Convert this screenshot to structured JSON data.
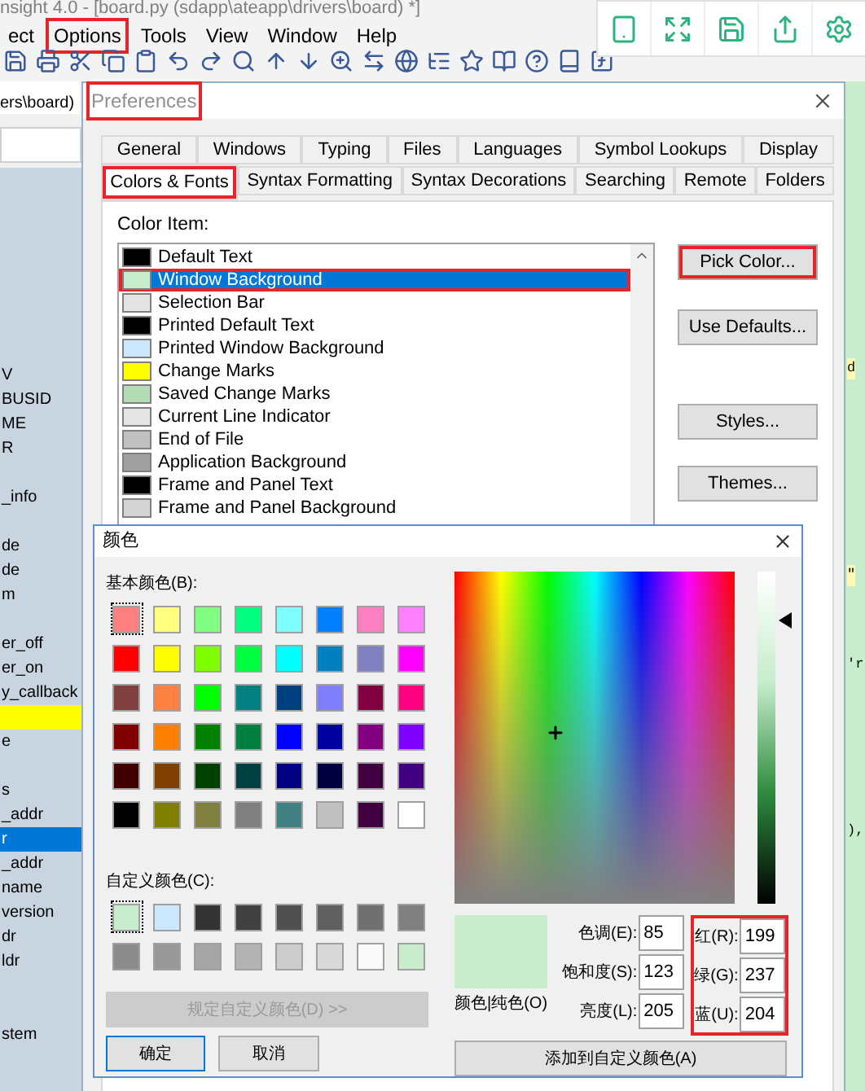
{
  "app": {
    "title": "nsight 4.0 - [board.py (sdapp\\ateapp\\drivers\\board) *]",
    "menu": [
      {
        "label": "ect",
        "highlighted": false
      },
      {
        "label": "Options",
        "highlighted": true
      },
      {
        "label": "Tools",
        "highlighted": false
      },
      {
        "label": "View",
        "highlighted": false
      },
      {
        "label": "Window",
        "highlighted": false
      },
      {
        "label": "Help",
        "highlighted": false
      }
    ]
  },
  "sidebar": {
    "tab": "ers\\board)",
    "rows": [
      {
        "kind": "blank"
      },
      {
        "kind": "blank"
      },
      {
        "kind": "blank"
      },
      {
        "kind": "blank"
      },
      {
        "kind": "blank"
      },
      {
        "kind": "blank"
      },
      {
        "kind": "blank"
      },
      {
        "kind": "blank"
      },
      {
        "kind": "text",
        "text": "V",
        "selected": false
      },
      {
        "kind": "text",
        "text": "BUSID",
        "selected": false
      },
      {
        "kind": "text",
        "text": "ME",
        "selected": false
      },
      {
        "kind": "text",
        "text": "R",
        "selected": false
      },
      {
        "kind": "blank"
      },
      {
        "kind": "text",
        "text": "_info",
        "selected": false
      },
      {
        "kind": "blank"
      },
      {
        "kind": "text",
        "text": "de",
        "selected": false
      },
      {
        "kind": "text",
        "text": "de",
        "selected": false
      },
      {
        "kind": "text",
        "text": "m",
        "selected": false
      },
      {
        "kind": "blank"
      },
      {
        "kind": "text",
        "text": "er_off",
        "selected": false
      },
      {
        "kind": "text",
        "text": "er_on",
        "selected": false
      },
      {
        "kind": "text",
        "text": "y_callback",
        "selected": false
      },
      {
        "kind": "blank",
        "selected": false,
        "marked": true
      },
      {
        "kind": "text",
        "text": "e",
        "selected": false
      },
      {
        "kind": "blank"
      },
      {
        "kind": "text",
        "text": "s",
        "selected": false
      },
      {
        "kind": "text",
        "text": "_addr",
        "selected": false
      },
      {
        "kind": "text",
        "text": "r",
        "selected": true
      },
      {
        "kind": "text",
        "text": "_addr",
        "selected": false
      },
      {
        "kind": "text",
        "text": "name",
        "selected": false
      },
      {
        "kind": "text",
        "text": "version",
        "selected": false
      },
      {
        "kind": "text",
        "text": "dr",
        "selected": false
      },
      {
        "kind": "text",
        "text": "ldr",
        "selected": false
      },
      {
        "kind": "blank"
      },
      {
        "kind": "blank"
      },
      {
        "kind": "text",
        "text": "stem",
        "selected": false
      }
    ]
  },
  "editor": {
    "fragments": [
      {
        "text": "d",
        "marked": true
      },
      {
        "text": "\"",
        "marked": true
      },
      {
        "text": "'r",
        "marked": false
      },
      {
        "text": "),",
        "marked": false
      }
    ]
  },
  "preferences": {
    "title": "Preferences",
    "highlighted": true,
    "tabs_back": [
      {
        "label": "General",
        "selected": false,
        "highlighted": false
      },
      {
        "label": "Windows",
        "selected": false,
        "highlighted": false
      },
      {
        "label": "Typing",
        "selected": false,
        "highlighted": false
      },
      {
        "label": "Files",
        "selected": false,
        "highlighted": false
      },
      {
        "label": "Languages",
        "selected": false,
        "highlighted": false
      },
      {
        "label": "Symbol Lookups",
        "selected": false,
        "highlighted": false
      },
      {
        "label": "Display",
        "selected": false,
        "highlighted": false
      }
    ],
    "tabs_front": [
      {
        "label": "Colors & Fonts",
        "selected": true,
        "highlighted": true
      },
      {
        "label": "Syntax Formatting",
        "selected": false,
        "highlighted": false
      },
      {
        "label": "Syntax Decorations",
        "selected": false,
        "highlighted": false
      },
      {
        "label": "Searching",
        "selected": false,
        "highlighted": false
      },
      {
        "label": "Remote",
        "selected": false,
        "highlighted": false
      },
      {
        "label": "Folders",
        "selected": false,
        "highlighted": false
      }
    ],
    "color_item_label": "Color Item:",
    "color_items": [
      {
        "label": "Default Text",
        "color": "#000000",
        "selected": false,
        "highlighted": false
      },
      {
        "label": "Window Background",
        "color": "#c7edcc",
        "selected": true,
        "highlighted": true
      },
      {
        "label": "Selection Bar",
        "color": "#e4e4e4",
        "selected": false,
        "highlighted": false
      },
      {
        "label": "Printed Default Text",
        "color": "#000000",
        "selected": false,
        "highlighted": false
      },
      {
        "label": "Printed Window Background",
        "color": "#cce8ff",
        "selected": false,
        "highlighted": false
      },
      {
        "label": "Change Marks",
        "color": "#ffff00",
        "selected": false,
        "highlighted": false
      },
      {
        "label": "Saved Change Marks",
        "color": "#b4dcb4",
        "selected": false,
        "highlighted": false
      },
      {
        "label": "Current Line Indicator",
        "color": "#e6e6e6",
        "selected": false,
        "highlighted": false
      },
      {
        "label": "End of File",
        "color": "#c0c0c0",
        "selected": false,
        "highlighted": false
      },
      {
        "label": "Application Background",
        "color": "#a0a0a0",
        "selected": false,
        "highlighted": false
      },
      {
        "label": "Frame and Panel Text",
        "color": "#000000",
        "selected": false,
        "highlighted": false
      },
      {
        "label": "Frame and Panel Background",
        "color": "#d4d4d4",
        "selected": false,
        "highlighted": false
      }
    ],
    "buttons": [
      {
        "label": "Pick Color...",
        "highlighted": true
      },
      {
        "label": "Use Defaults...",
        "highlighted": false
      },
      {
        "label": "Styles...",
        "highlighted": false
      },
      {
        "label": "Themes...",
        "highlighted": false
      }
    ]
  },
  "color_dialog": {
    "title": "颜色",
    "basic_label": "基本颜色(B):",
    "basic_colors": [
      {
        "color": "#ff8080",
        "selected": true
      },
      {
        "color": "#ffff80",
        "selected": false
      },
      {
        "color": "#80ff80",
        "selected": false
      },
      {
        "color": "#00ff80",
        "selected": false
      },
      {
        "color": "#80ffff",
        "selected": false
      },
      {
        "color": "#0080ff",
        "selected": false
      },
      {
        "color": "#ff80c0",
        "selected": false
      },
      {
        "color": "#ff80ff",
        "selected": false
      },
      {
        "color": "#ff0000",
        "selected": false
      },
      {
        "color": "#ffff00",
        "selected": false
      },
      {
        "color": "#80ff00",
        "selected": false
      },
      {
        "color": "#00ff40",
        "selected": false
      },
      {
        "color": "#00ffff",
        "selected": false
      },
      {
        "color": "#0080c0",
        "selected": false
      },
      {
        "color": "#8080c0",
        "selected": false
      },
      {
        "color": "#ff00ff",
        "selected": false
      },
      {
        "color": "#804040",
        "selected": false
      },
      {
        "color": "#ff8040",
        "selected": false
      },
      {
        "color": "#00ff00",
        "selected": false
      },
      {
        "color": "#008080",
        "selected": false
      },
      {
        "color": "#004080",
        "selected": false
      },
      {
        "color": "#8080ff",
        "selected": false
      },
      {
        "color": "#800040",
        "selected": false
      },
      {
        "color": "#ff0080",
        "selected": false
      },
      {
        "color": "#800000",
        "selected": false
      },
      {
        "color": "#ff8000",
        "selected": false
      },
      {
        "color": "#008000",
        "selected": false
      },
      {
        "color": "#008040",
        "selected": false
      },
      {
        "color": "#0000ff",
        "selected": false
      },
      {
        "color": "#0000a0",
        "selected": false
      },
      {
        "color": "#800080",
        "selected": false
      },
      {
        "color": "#8000ff",
        "selected": false
      },
      {
        "color": "#400000",
        "selected": false
      },
      {
        "color": "#804000",
        "selected": false
      },
      {
        "color": "#004000",
        "selected": false
      },
      {
        "color": "#004040",
        "selected": false
      },
      {
        "color": "#000080",
        "selected": false
      },
      {
        "color": "#000040",
        "selected": false
      },
      {
        "color": "#400040",
        "selected": false
      },
      {
        "color": "#400080",
        "selected": false
      },
      {
        "color": "#000000",
        "selected": false
      },
      {
        "color": "#808000",
        "selected": false
      },
      {
        "color": "#808040",
        "selected": false
      },
      {
        "color": "#808080",
        "selected": false
      },
      {
        "color": "#408080",
        "selected": false
      },
      {
        "color": "#c0c0c0",
        "selected": false
      },
      {
        "color": "#400040",
        "selected": false
      },
      {
        "color": "#ffffff",
        "selected": false
      }
    ],
    "custom_label": "自定义颜色(C):",
    "custom_colors": [
      {
        "color": "#c7edcc",
        "selected": true
      },
      {
        "color": "#cce8ff",
        "selected": false
      },
      {
        "color": "#333333",
        "selected": false
      },
      {
        "color": "#404040",
        "selected": false
      },
      {
        "color": "#505050",
        "selected": false
      },
      {
        "color": "#606060",
        "selected": false
      },
      {
        "color": "#707070",
        "selected": false
      },
      {
        "color": "#808080",
        "selected": false
      },
      {
        "color": "#8c8c8c",
        "selected": false
      },
      {
        "color": "#999999",
        "selected": false
      },
      {
        "color": "#a6a6a6",
        "selected": false
      },
      {
        "color": "#b3b3b3",
        "selected": false
      },
      {
        "color": "#cccccc",
        "selected": false
      },
      {
        "color": "#d9d9d9",
        "selected": false
      },
      {
        "color": "#fafafa",
        "selected": false
      },
      {
        "color": "#c7edcc",
        "selected": false
      }
    ],
    "define_custom_button": {
      "label": "规定自定义颜色(D) >>",
      "disabled": true
    },
    "ok_button": "确定",
    "cancel_button": "取消",
    "preview_label": "颜色|纯色(O)",
    "hsl_fields": [
      {
        "label": "色调(E):",
        "value": "85"
      },
      {
        "label": "饱和度(S):",
        "value": "123"
      },
      {
        "label": "亮度(L):",
        "value": "205"
      }
    ],
    "rgb_fields": [
      {
        "label": "红(R):",
        "value": "199"
      },
      {
        "label": "绿(G):",
        "value": "237"
      },
      {
        "label": "蓝(U):",
        "value": "204"
      }
    ],
    "rgb_highlighted": true,
    "add_custom_button": "添加到自定义颜色(A)"
  }
}
